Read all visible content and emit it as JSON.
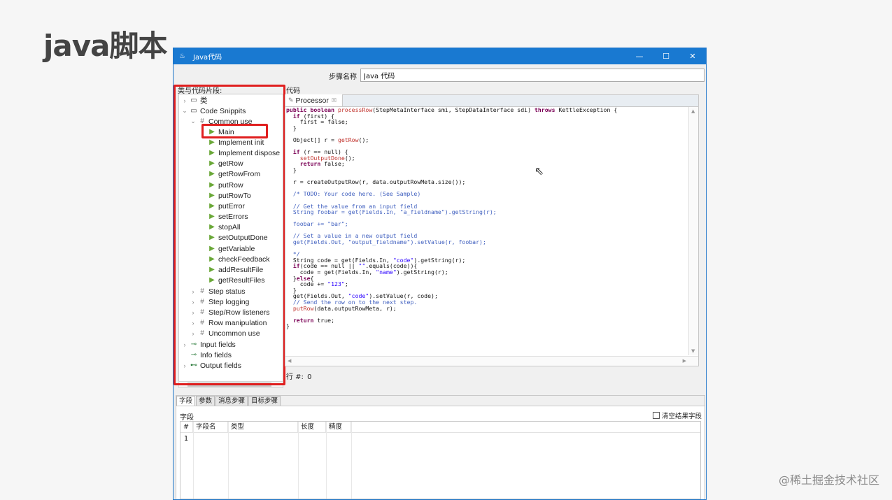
{
  "slide": {
    "title": "java脚本",
    "watermark": "@稀土掘金技术社区"
  },
  "window": {
    "title": "Java代码",
    "app_icon": "java-icon",
    "controls": {
      "minimize": "—",
      "maximize": "☐",
      "close": "✕"
    }
  },
  "step": {
    "label": "步骤名称",
    "value": "Java 代码"
  },
  "left": {
    "label": "类与代码片段:",
    "tree": [
      {
        "label": "类",
        "icon": "folder-icon"
      },
      {
        "label": "Code Snippits",
        "icon": "folder-icon"
      },
      {
        "label": "Common use",
        "icon": "hash-icon"
      },
      {
        "label": "Main",
        "icon": "play-icon"
      },
      {
        "label": "Implement init",
        "icon": "play-icon"
      },
      {
        "label": "Implement dispose",
        "icon": "play-icon"
      },
      {
        "label": "getRow",
        "icon": "play-icon"
      },
      {
        "label": "getRowFrom",
        "icon": "play-icon"
      },
      {
        "label": "putRow",
        "icon": "play-icon"
      },
      {
        "label": "putRowTo",
        "icon": "play-icon"
      },
      {
        "label": "putError",
        "icon": "play-icon"
      },
      {
        "label": "setErrors",
        "icon": "play-icon"
      },
      {
        "label": "stopAll",
        "icon": "play-icon"
      },
      {
        "label": "setOutputDone",
        "icon": "play-icon"
      },
      {
        "label": "getVariable",
        "icon": "play-icon"
      },
      {
        "label": "checkFeedback",
        "icon": "play-icon"
      },
      {
        "label": "addResultFile",
        "icon": "play-icon"
      },
      {
        "label": "getResultFiles",
        "icon": "play-icon"
      },
      {
        "label": "Step status",
        "icon": "hash-icon"
      },
      {
        "label": "Step logging",
        "icon": "hash-icon"
      },
      {
        "label": "Step/Row listeners",
        "icon": "hash-icon"
      },
      {
        "label": "Row manipulation",
        "icon": "hash-icon"
      },
      {
        "label": "Uncommon use",
        "icon": "hash-icon"
      },
      {
        "label": "Input fields",
        "icon": "input-fields-icon"
      },
      {
        "label": "Info fields",
        "icon": "info-fields-icon"
      },
      {
        "label": "Output fields",
        "icon": "output-fields-icon"
      }
    ]
  },
  "code": {
    "label": "代码",
    "tab": "Processor",
    "line_counter_label": "行 #:",
    "line_counter_value": "0"
  },
  "bottom": {
    "tabs": [
      "字段",
      "参数",
      "消息步骤",
      "目标步骤"
    ],
    "fields_label": "字段",
    "clear_checkbox": "清空结果字段",
    "columns": [
      "#",
      "字段名",
      "类型",
      "长度",
      "精度"
    ],
    "row_numbers": [
      "1"
    ]
  }
}
